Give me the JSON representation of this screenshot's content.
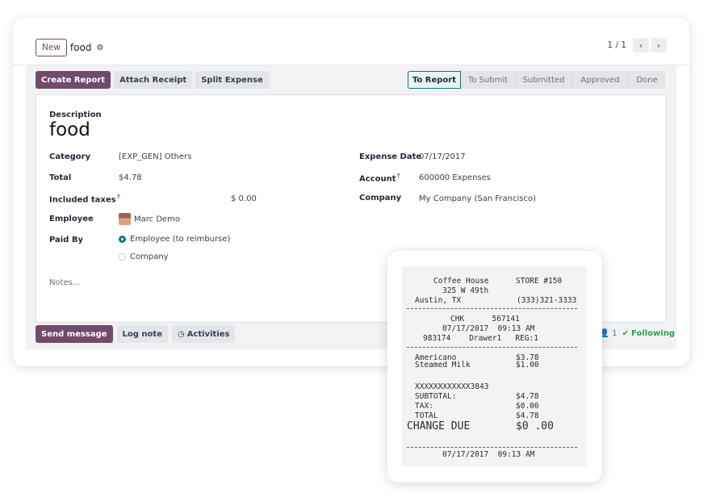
{
  "header": {
    "new_label": "New",
    "title": "food",
    "pager_count": "1 / 1"
  },
  "toolbar": {
    "create_report": "Create Report",
    "attach_receipt": "Attach Receipt",
    "split_expense": "Split Expense"
  },
  "statusbar": [
    "To Report",
    "To Submit",
    "Submitted",
    "Approved",
    "Done"
  ],
  "form": {
    "description_label": "Description",
    "description_value": "food",
    "category_label": "Category",
    "category_value": "[EXP_GEN] Others",
    "total_label": "Total",
    "total_value": "$4.78",
    "taxes_label": "Included taxes",
    "taxes_value": "$ 0.00",
    "employee_label": "Employee",
    "employee_value": "Marc Demo",
    "paidby_label": "Paid By",
    "paidby_options": [
      "Employee (to reimburse)",
      "Company"
    ],
    "paidby_selected": "Employee (to reimburse)",
    "expense_date_label": "Expense Date",
    "expense_date_value": "07/17/2017",
    "account_label": "Account",
    "account_value": "600000 Expenses",
    "company_label": "Company",
    "company_value": "My Company (San Francisco)",
    "notes_placeholder": "Notes...",
    "help_mark": "?"
  },
  "chatter": {
    "send_message": "Send message",
    "log_note": "Log note",
    "activities": "Activities",
    "followers_count": "1",
    "following": "Following"
  },
  "receipt": {
    "line1_left": "Coffee House",
    "line1_right": "STORE #150",
    "line2": "325 W 49th",
    "line3_left": "Austin, TX",
    "line3_right": "(333)321-3333",
    "chk": "CHK      567141",
    "datetime": "07/17/2017  09:13 AM",
    "drawer": "983174    Drawer1   REG:1",
    "item1_name": "Americano",
    "item1_price": "$3.78",
    "item2_name": "Steamed Milk",
    "item2_price": "$1.00",
    "card": "XXXXXXXXXXXX3843",
    "subtotal_label": "SUBTOTAL:",
    "subtotal_value": "$4.78",
    "tax_label": "TAX:",
    "tax_value": "$0.00",
    "total_label": "TOTAL",
    "total_value": "$4.78",
    "change_label": "CHANGE DUE",
    "change_value": "$0 .00",
    "footer_datetime": "07/17/2017  09:13 AM"
  },
  "colors": {
    "primary": "#714b67",
    "accent": "#017e84",
    "following": "#28a745"
  }
}
